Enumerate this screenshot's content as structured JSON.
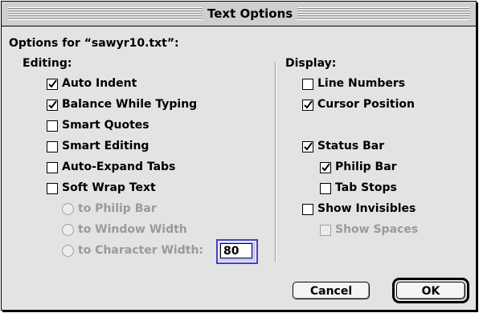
{
  "window": {
    "title": "Text Options"
  },
  "header": "Options for “sawyr10.txt”:",
  "editing": {
    "label": "Editing:",
    "items": [
      {
        "label": "Auto Indent",
        "checked": true
      },
      {
        "label": "Balance While Typing",
        "checked": true
      },
      {
        "label": "Smart Quotes",
        "checked": false
      },
      {
        "label": "Smart Editing",
        "checked": false
      },
      {
        "label": "Auto-Expand Tabs",
        "checked": false
      },
      {
        "label": "Soft Wrap Text",
        "checked": false
      }
    ],
    "wrap_options": [
      {
        "label": "to Philip Bar",
        "selected": false,
        "enabled": false
      },
      {
        "label": "to Window Width",
        "selected": false,
        "enabled": false
      },
      {
        "label": "to Character Width:",
        "selected": false,
        "enabled": false
      }
    ],
    "char_width_value": "80"
  },
  "display": {
    "label": "Display:",
    "items": [
      {
        "label": "Line Numbers",
        "checked": false
      },
      {
        "label": "Cursor Position",
        "checked": true
      },
      {
        "label": "Status Bar",
        "checked": true
      },
      {
        "label": "Philip Bar",
        "checked": true
      },
      {
        "label": "Tab Stops",
        "checked": false
      },
      {
        "label": "Show Invisibles",
        "checked": false
      },
      {
        "label": "Show Spaces",
        "checked": false,
        "enabled": false
      }
    ]
  },
  "buttons": {
    "cancel": "Cancel",
    "ok": "OK"
  }
}
